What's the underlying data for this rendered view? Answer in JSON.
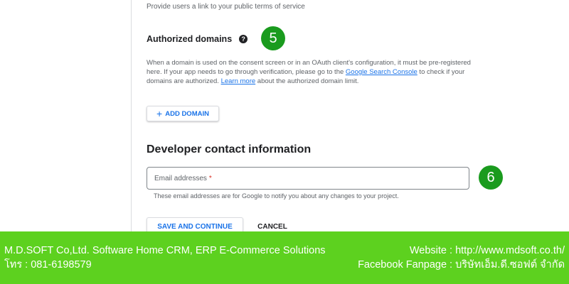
{
  "form": {
    "terms_helper": "Provide users a link to your public terms of service",
    "authorized_domains": {
      "title": "Authorized domains",
      "help_icon": "question-circle-icon",
      "description_part1": "When a domain is used on the consent screen or in an OAuth client's configuration, it must be pre-registered here. If your app needs to go through verification, please go to the ",
      "link_search_console": "Google Search Console",
      "description_part2": " to check if your domains are authorized. ",
      "link_learn_more": "Learn more",
      "description_part3": " about the authorized domain limit.",
      "add_button_label": "ADD DOMAIN",
      "add_button_icon": "plus-icon"
    },
    "developer_contact": {
      "title": "Developer contact information",
      "email_placeholder": "Email addresses",
      "required_mark": "*",
      "email_helper": "These email addresses are for Google to notify you about any changes to your project."
    },
    "actions": {
      "save_label": "SAVE AND CONTINUE",
      "cancel_label": "CANCEL"
    }
  },
  "annotations": {
    "badge_5": "5",
    "badge_6": "6",
    "badge_color": "#1a9b1e"
  },
  "footer": {
    "company": "M.D.SOFT Co,Ltd. Software Home CRM, ERP E-Commerce Solutions",
    "website": "Website : http://www.mdsoft.co.th/",
    "phone": "โทร : 081-6198579",
    "fanpage": "Facebook Fanpage : บริษัทเอ็ม.ดี.ซอฟต์ จำกัด",
    "background_color": "#5dd11f"
  },
  "colors": {
    "link": "#1a73e8",
    "required": "#d93025"
  }
}
